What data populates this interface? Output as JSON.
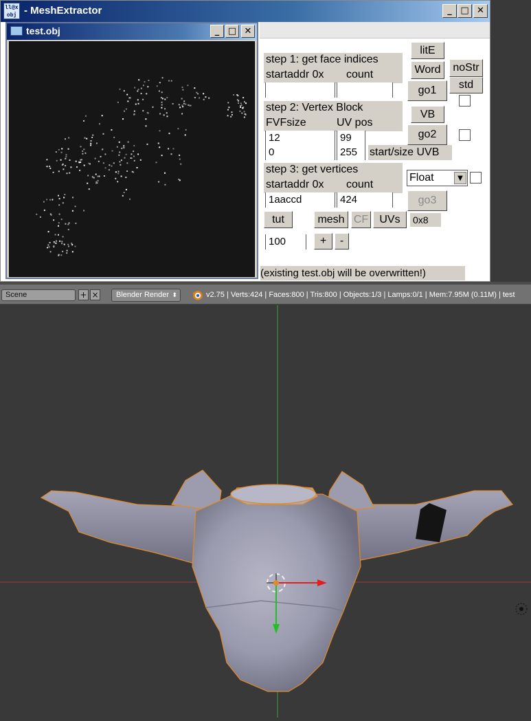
{
  "meshextractor": {
    "icon_text_top": "ll@x",
    "icon_text_bottom": "obj",
    "title": "- MeshExtractor",
    "child_title": "test.obj",
    "step1": {
      "heading": "step 1: get face indices",
      "addr_label": "startaddr 0x",
      "count_label": "count",
      "addr_value": "",
      "count_value": ""
    },
    "step2": {
      "heading": "step 2: Vertex Block",
      "fvf_label": "FVFsize",
      "uv_label": "UV pos",
      "fvf_value": "12",
      "uv_value": "99",
      "start_value": "0",
      "size_value": "255",
      "uvb_label": "start/size UVB"
    },
    "step3": {
      "heading": "step 3: get vertices",
      "addr_label": "startaddr 0x",
      "count_label": "count",
      "addr_value": "1aaccd",
      "count_value": "424",
      "type_select": "Float"
    },
    "buttons": {
      "lite": "litE",
      "word": "Word",
      "nostr": "noStr",
      "std": "std",
      "go1": "go1",
      "vb": "VB",
      "go2": "go2",
      "go3": "go3",
      "tut": "tut",
      "mesh": "mesh",
      "cf": "CF",
      "uvs": "UVs",
      "plus": "+",
      "minus": "-"
    },
    "offset_label": "0x8",
    "zoom_value": "100",
    "warning": "(existing test.obj will be overwritten!)"
  },
  "blender": {
    "scene": "Scene",
    "render_engine": "Blender Render",
    "stats": "v2.75 | Verts:424 | Faces:800 | Tris:800 | Objects:1/3 | Lamps:0/1 | Mem:7.95M (0.11M) | test"
  },
  "colors": {
    "titlebar": "#0a246a",
    "face_gray": "#d4d0c8",
    "mesh": "#9a9ab0",
    "outline": "#e08a2a"
  },
  "icons": [
    "app-icon",
    "minimize-icon",
    "maximize-icon",
    "close-icon",
    "blender-logo-icon",
    "add-icon",
    "remove-icon",
    "dropdown-icon",
    "3d-cursor-icon",
    "view-orbit-icon"
  ]
}
